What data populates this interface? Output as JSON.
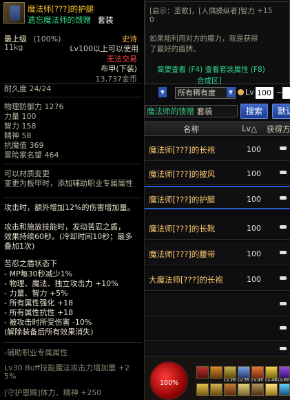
{
  "tooltip": {
    "item_name": "魔法师[???]的护腿",
    "set_name": "遗忘魔法师的馈赠",
    "set_badge": "套装",
    "top_grade": "最上级",
    "top_grade_pct": "(100%)",
    "rarity": "史诗",
    "weight": "11kg",
    "level_req": "Lv100以上可以使用",
    "trade": "无法交易",
    "armor_type": "布甲(下装)",
    "price": "13,737金币",
    "durability": "耐久度 24/24",
    "stats": [
      "物理防御力 1276",
      "力量 100",
      "智力 158",
      "精神 58",
      "抗魔值 369",
      "冒险家名望 464"
    ],
    "material_change": "可以材质变更",
    "change_note": "变更为板甲时，添加辅助职业专属属性",
    "effect1": "攻击时，额外增加12%的伤害增加量。",
    "effect2_l1": "攻击和施放技能时，发动苦忍之盾，",
    "effect2_l2": "效果持续60秒。(冷却时间10秒；最多",
    "effect2_l3": "叠加1次)",
    "buff_title": "苦忍之盾状态下",
    "buff_lines": [
      "- MP每30秒减少1%",
      "- 物理、魔法、独立攻击力 +10%",
      "- 力量、智力 +5%",
      "- 所有属性强化 +18",
      "- 所有属性抗性 +18",
      "- 被攻击时所受伤害 -10%",
      "(解除装备后所有效果消失)"
    ],
    "aux_title": "-辅助职业专属属性",
    "aux_l1": "Lv30 Buff技能魔法攻击力增加量 +2",
    "aux_l2": "5%",
    "aux_l3": "[守护恩赐]体力、精神 +250"
  },
  "hint": {
    "line1": "[启示：圣歌]，[人偶操纵者]智力 +15",
    "line2": "0",
    "line3": "如果能利用对方的魔力，就是获得",
    "line4": "了最好的盾牌。",
    "link1": "简要查看 (F4) 查看套装属性 (F8)",
    "link2": "合成区]"
  },
  "filters": {
    "rarity_select": "所有稀有度",
    "lv_label": "Lv",
    "lv_min": "100",
    "lv_tilde": "~"
  },
  "set_search": {
    "set_label": "魔法师的馈赠",
    "set_tag": "套装",
    "search_button": "搜索",
    "default_button": "默认"
  },
  "table": {
    "col_name": "名称",
    "col_lv": "Lv△",
    "col_obtain": "获得方",
    "rows": [
      {
        "name": "魔法师[???]的长袍",
        "lv": "100"
      },
      {
        "name": "魔法师[???]的披风",
        "lv": "100"
      },
      {
        "name": "魔法师[???]的护腿",
        "lv": "100"
      },
      {
        "name": "魔法师[???]的长靴",
        "lv": "100"
      },
      {
        "name": "魔法师[???]的腰带",
        "lv": "100"
      },
      {
        "name": "大魔法师[???]的长袍",
        "lv": "100"
      },
      {
        "name": "",
        "lv": ""
      },
      {
        "name": "",
        "lv": ""
      },
      {
        "name": "",
        "lv": ""
      }
    ]
  },
  "hud": {
    "hp_orb": "100%",
    "slot_labels": [
      "Lv.26",
      "Lv.35",
      "Lv.45",
      "Lv.48",
      "Lv.60"
    ]
  },
  "colors": {
    "item_name": "#ffc22a",
    "set_green": "#2fe08c",
    "rarity_epic": "#ffb23e",
    "untradeable": "#ff4545",
    "accent_blue": "#2c55b0"
  }
}
